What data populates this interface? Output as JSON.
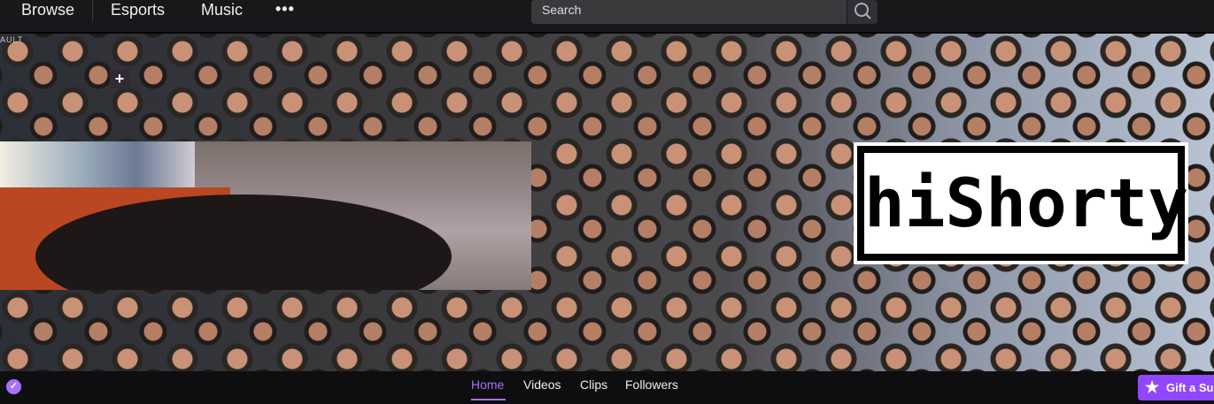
{
  "topnav": {
    "items": [
      {
        "label": "Browse"
      },
      {
        "label": "Esports"
      },
      {
        "label": "Music"
      }
    ],
    "more_label": "•••",
    "search": {
      "placeholder": "Search",
      "icon": "search-icon"
    }
  },
  "banner": {
    "logo_text": "hiShorty",
    "overlay_label": "AULT",
    "plus_label": "+"
  },
  "channel_tabs": [
    {
      "label": "Home",
      "active": true
    },
    {
      "label": "Videos",
      "active": false
    },
    {
      "label": "Clips",
      "active": false
    },
    {
      "label": "Followers",
      "active": false
    }
  ],
  "gift_button": {
    "label": "Gift a Sub",
    "icon": "star-icon"
  },
  "verified_badge": {
    "icon": "checkmark-icon"
  },
  "colors": {
    "accent": "#a970ff",
    "brand": "#9147ff",
    "topnav_bg": "#18181b"
  }
}
